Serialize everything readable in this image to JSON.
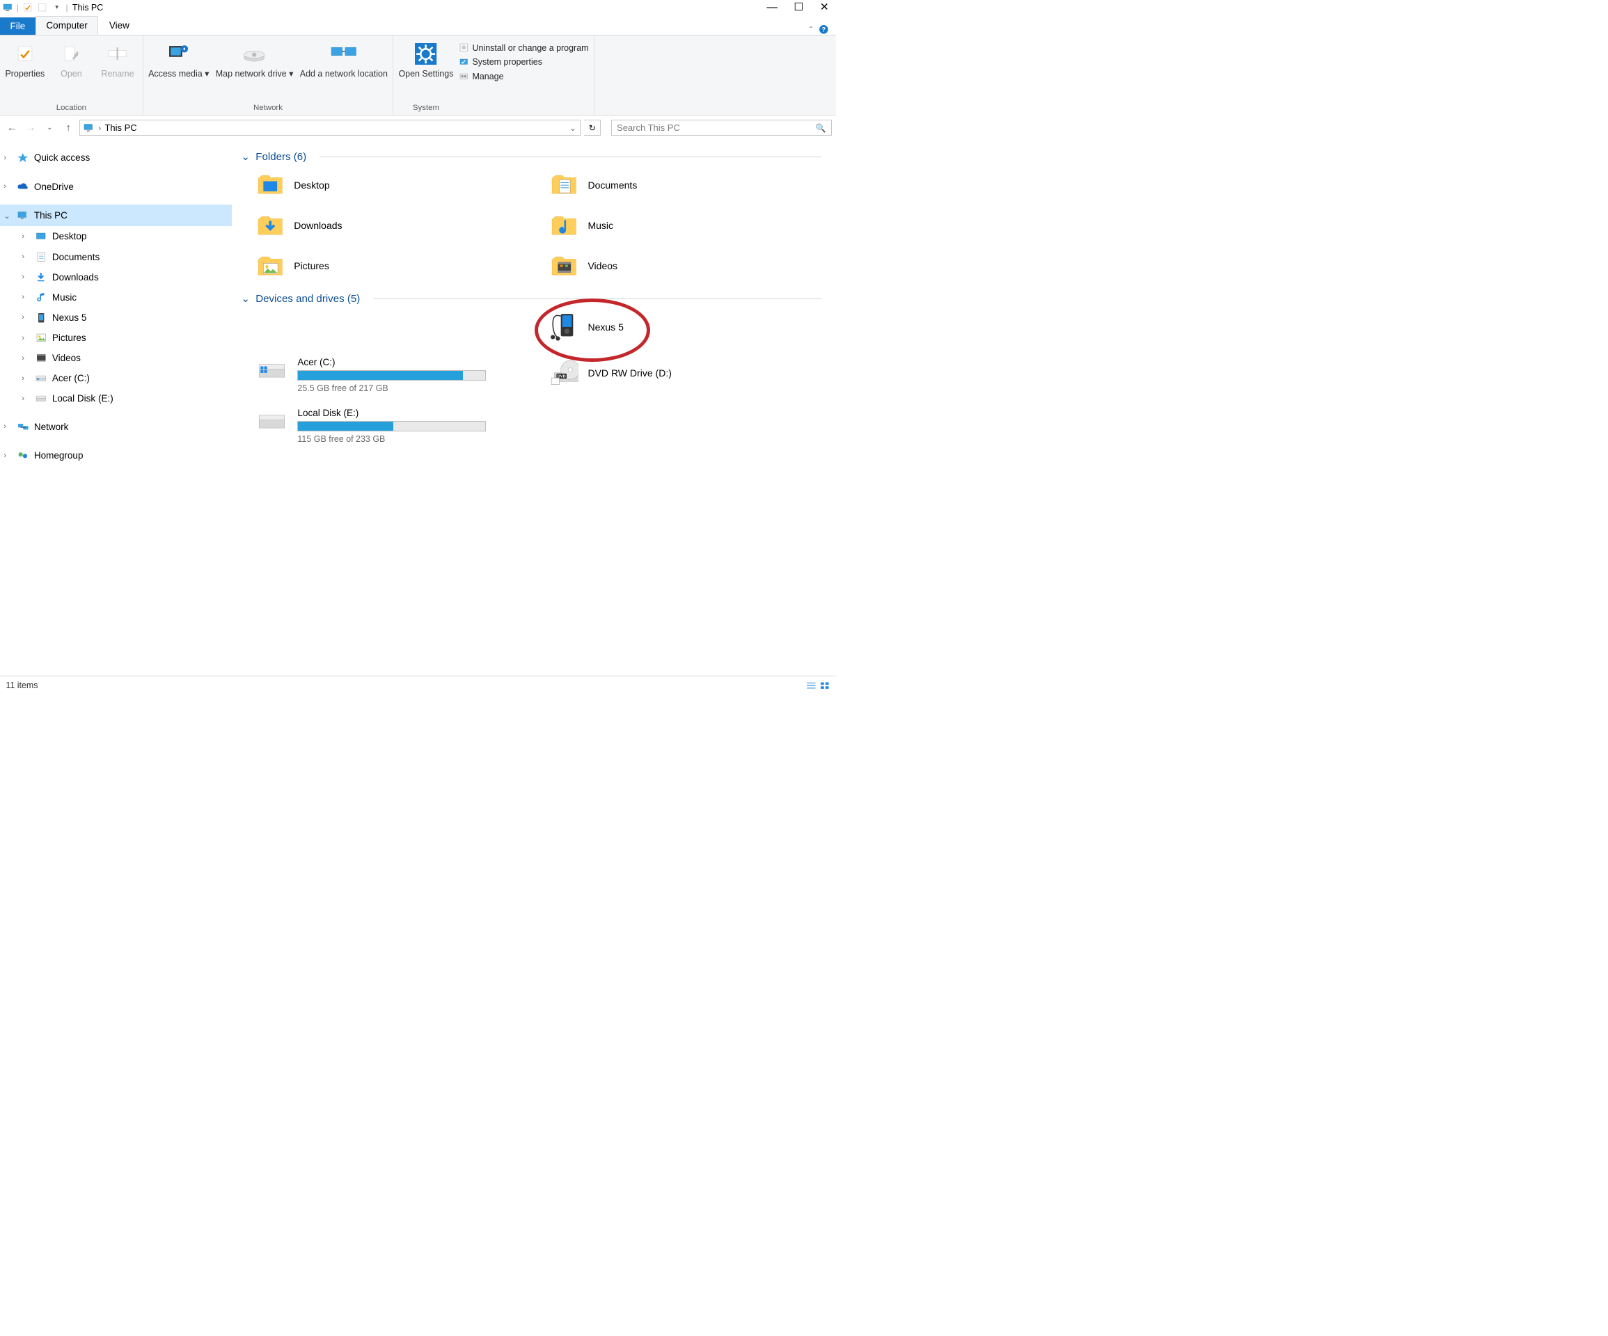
{
  "titlebar": {
    "title": "This PC"
  },
  "tabs": {
    "file": "File",
    "computer": "Computer",
    "view": "View"
  },
  "ribbon": {
    "location": {
      "label": "Location",
      "properties": "Properties",
      "open": "Open",
      "rename": "Rename"
    },
    "network": {
      "label": "Network",
      "access_media": "Access media",
      "map_drive": "Map network drive",
      "add_location": "Add a network location"
    },
    "system": {
      "label": "System",
      "open_settings": "Open Settings",
      "uninstall": "Uninstall or change a program",
      "system_properties": "System properties",
      "manage": "Manage"
    }
  },
  "nav": {
    "crumb": "This PC",
    "search_placeholder": "Search This PC"
  },
  "tree": {
    "quick_access": "Quick access",
    "onedrive": "OneDrive",
    "this_pc": "This PC",
    "children": [
      "Desktop",
      "Documents",
      "Downloads",
      "Music",
      "Nexus 5",
      "Pictures",
      "Videos",
      "Acer (C:)",
      "Local Disk (E:)"
    ],
    "network": "Network",
    "homegroup": "Homegroup"
  },
  "content": {
    "folders_head": "Folders (6)",
    "devices_head": "Devices and drives (5)",
    "folders": [
      "Desktop",
      "Documents",
      "Downloads",
      "Music",
      "Pictures",
      "Videos"
    ],
    "nexus": "Nexus 5",
    "acer": {
      "name": "Acer (C:)",
      "free": "25.5 GB free of 217 GB",
      "pct": 88
    },
    "dvd": "DVD RW Drive (D:)",
    "local": {
      "name": "Local Disk (E:)",
      "free": "115 GB free of 233 GB",
      "pct": 51
    }
  },
  "status": {
    "count": "11 items"
  }
}
